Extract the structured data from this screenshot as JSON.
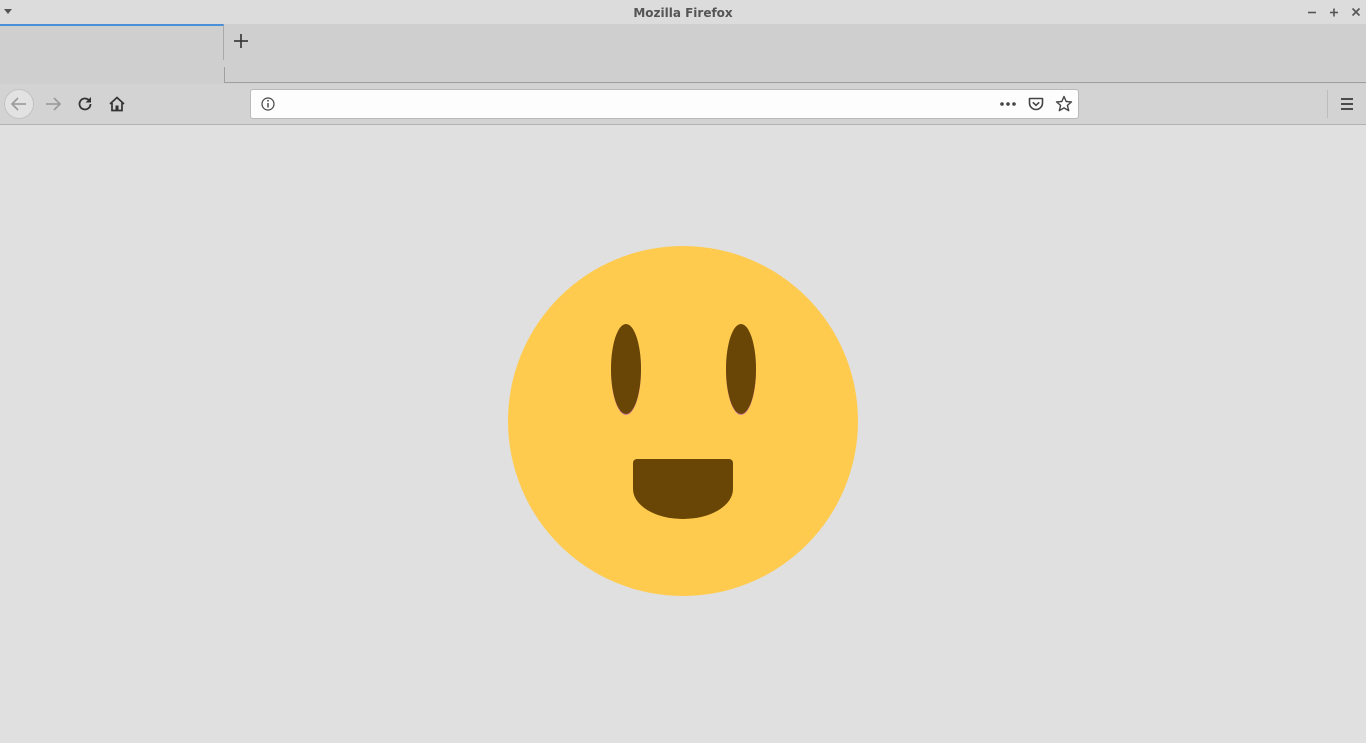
{
  "window": {
    "title": "Mozilla Firefox"
  },
  "tabs": {
    "new_tab_icon": "plus-icon"
  },
  "navbar": {
    "url_value": "",
    "url_placeholder": "",
    "icons": [
      "back-arrow-icon",
      "forward-arrow-icon",
      "reload-icon",
      "home-icon",
      "info-icon",
      "more-dots-icon",
      "pocket-icon",
      "bookmark-star-icon",
      "hamburger-menu-icon"
    ]
  },
  "colors": {
    "face": "#fecb4f",
    "features": "#6a4606",
    "tab_accent": "#4a90d9",
    "background": "#e0e0e0"
  }
}
